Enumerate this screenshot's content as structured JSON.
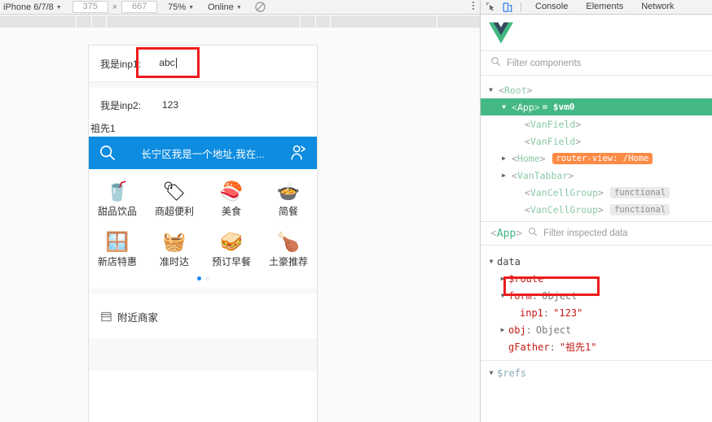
{
  "device_toolbar": {
    "device_name": "iPhone 6/7/8",
    "width": "375",
    "height": "667",
    "times_symbol": "×",
    "zoom": "75%",
    "throttle": "Online",
    "throttle_icon": "no-throttling-icon",
    "caret_icon": "▼",
    "menu_icon": "kebab-menu-icon"
  },
  "phone": {
    "cells": [
      {
        "label": "我是inp1:",
        "value": "abc"
      },
      {
        "label": "我是inp2:",
        "value": "123"
      }
    ],
    "gfather_text": "祖先1",
    "search_bar": {
      "address": "长宁区我是一个地址,我在...",
      "background": "#0d8ce0",
      "search_icon": "search-icon",
      "user_icon": "user-account-icon"
    },
    "grid": [
      {
        "label": "甜品饮品",
        "icon": "🥤"
      },
      {
        "label": "商超便利",
        "icon": "🏷"
      },
      {
        "label": "美食",
        "icon": "🍣"
      },
      {
        "label": "简餐",
        "icon": "🍲"
      },
      {
        "label": "新店特惠",
        "icon": "🪟"
      },
      {
        "label": "准时达",
        "icon": "🧺"
      },
      {
        "label": "预订早餐",
        "icon": "🥪"
      },
      {
        "label": "土豪推荐",
        "icon": "🍗"
      }
    ],
    "carousel": {
      "total": 2,
      "active_index": 0,
      "active_color": "#1989fa"
    },
    "nearby": {
      "label": "附近商家",
      "icon": "shop-icon"
    },
    "highlight_color": "#ee1c1c"
  },
  "devtools": {
    "tabs": [
      "Console",
      "Elements",
      "Network"
    ],
    "inspect_icon": "inspect-element-icon",
    "device_toggle_icon": "device-toolbar-icon",
    "logo": "vue-logo",
    "component_filter_placeholder": "Filter components",
    "inspected_filter_placeholder": "Filter inspected data",
    "inspected_component": "App",
    "tree": [
      {
        "name": "Root",
        "depth": 0,
        "arrow": "▼",
        "selected": false,
        "badge": ""
      },
      {
        "name": "App",
        "depth": 1,
        "arrow": "▼",
        "selected": true,
        "badge": "",
        "vm": "= $vm0"
      },
      {
        "name": "VanField",
        "depth": 2,
        "arrow": "",
        "selected": false,
        "badge": ""
      },
      {
        "name": "VanField",
        "depth": 2,
        "arrow": "",
        "selected": false,
        "badge": ""
      },
      {
        "name": "Home",
        "depth": 2,
        "arrow": "▶",
        "selected": false,
        "badge": "router-view: /Home",
        "badge_type": "router"
      },
      {
        "name": "VanTabbar",
        "depth": 2,
        "arrow": "▶",
        "selected": false,
        "badge": ""
      },
      {
        "name": "VanCellGroup",
        "depth": 2,
        "arrow": "",
        "selected": false,
        "badge": "functional",
        "badge_type": "functional"
      },
      {
        "name": "VanCellGroup",
        "depth": 2,
        "arrow": "",
        "selected": false,
        "badge": "functional",
        "badge_type": "functional"
      }
    ],
    "data_tree": {
      "section": "data",
      "section_arrow": "▼",
      "rows": [
        {
          "arrow": "▶",
          "key": "$route",
          "sep": "",
          "value": "",
          "depth": 1,
          "key_style": "prop",
          "value_style": ""
        },
        {
          "arrow": "▼",
          "key": "form",
          "sep": ":",
          "value": "Object",
          "depth": 1,
          "key_style": "prop",
          "value_style": "type"
        },
        {
          "arrow": "",
          "key": "inp1",
          "sep": ":",
          "value": "\"123\"",
          "depth": 2,
          "key_style": "prop",
          "value_style": "str",
          "highlighted": true
        },
        {
          "arrow": "▶",
          "key": "obj",
          "sep": ":",
          "value": "Object",
          "depth": 2,
          "key_style": "prop",
          "value_style": "type"
        },
        {
          "arrow": "",
          "key": "gFather",
          "sep": ":",
          "value": "\"祖先1\"",
          "depth": 1,
          "key_style": "prop",
          "value_style": "str"
        }
      ],
      "refs_section": "$refs",
      "refs_arrow": "▼"
    },
    "colors": {
      "selected_row": "#44b883",
      "router_badge": "#ff8b46",
      "vue_green": "#41b883",
      "vue_navy": "#35495e",
      "highlight": "#ee1c1c"
    }
  }
}
